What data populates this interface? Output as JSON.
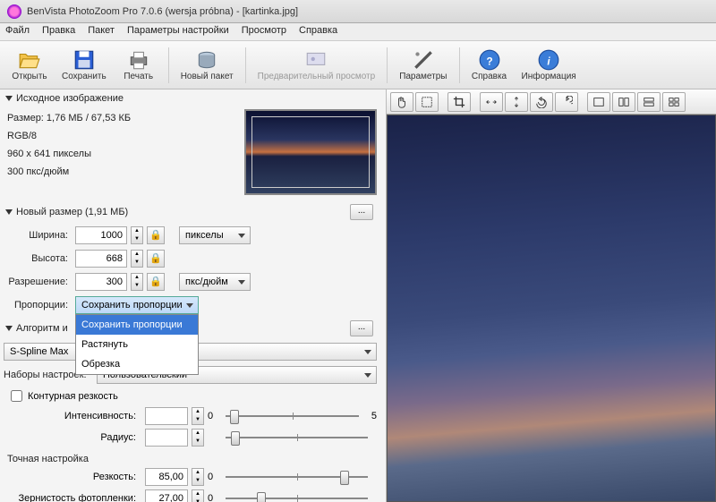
{
  "window": {
    "title": "BenVista PhotoZoom Pro 7.0.6 (wersja próbna) - [kartinka.jpg]"
  },
  "menu": {
    "file": "Файл",
    "edit": "Правка",
    "batch": "Пакет",
    "params": "Параметры настройки",
    "view": "Просмотр",
    "help": "Справка"
  },
  "toolbar": {
    "open": "Открыть",
    "save": "Сохранить",
    "print": "Печать",
    "newbatch": "Новый пакет",
    "preview": "Предварительный просмотр",
    "settings": "Параметры",
    "helpref": "Справка",
    "info": "Информация"
  },
  "src": {
    "header": "Исходное изображение",
    "size": "Размер: 1,76 МБ / 67,53 КБ",
    "mode": "RGB/8",
    "dims": "960 x 641 пикселы",
    "dpi": "300 пкс/дюйм"
  },
  "newsize": {
    "header": "Новый размер (1,91 МБ)",
    "width_label": "Ширина:",
    "width": "1000",
    "height_label": "Высота:",
    "height": "668",
    "unit_px": "пикселы",
    "res_label": "Разрешение:",
    "res": "300",
    "unit_dpi": "пкс/дюйм",
    "aspect_label": "Пропорции:",
    "aspect_value": "Сохранить пропорции",
    "aspect_opts": [
      "Сохранить пропорции",
      "Растянуть",
      "Обрезка"
    ]
  },
  "algo": {
    "header": "Алгоритм и",
    "method": "S-Spline Max"
  },
  "presets": {
    "label": "Наборы настроек:",
    "value": "Пользовательский"
  },
  "contour": {
    "label": "Контурная резкость",
    "intensity": "Интенсивность:",
    "radius": "Радиус:"
  },
  "fine": {
    "header": "Точная настройка",
    "sharp_label": "Резкость:",
    "sharp": "85,00",
    "grain_label": "Зернистость фотопленки:",
    "grain": "27,00",
    "scale_min": "0",
    "scale_mid": "5"
  }
}
